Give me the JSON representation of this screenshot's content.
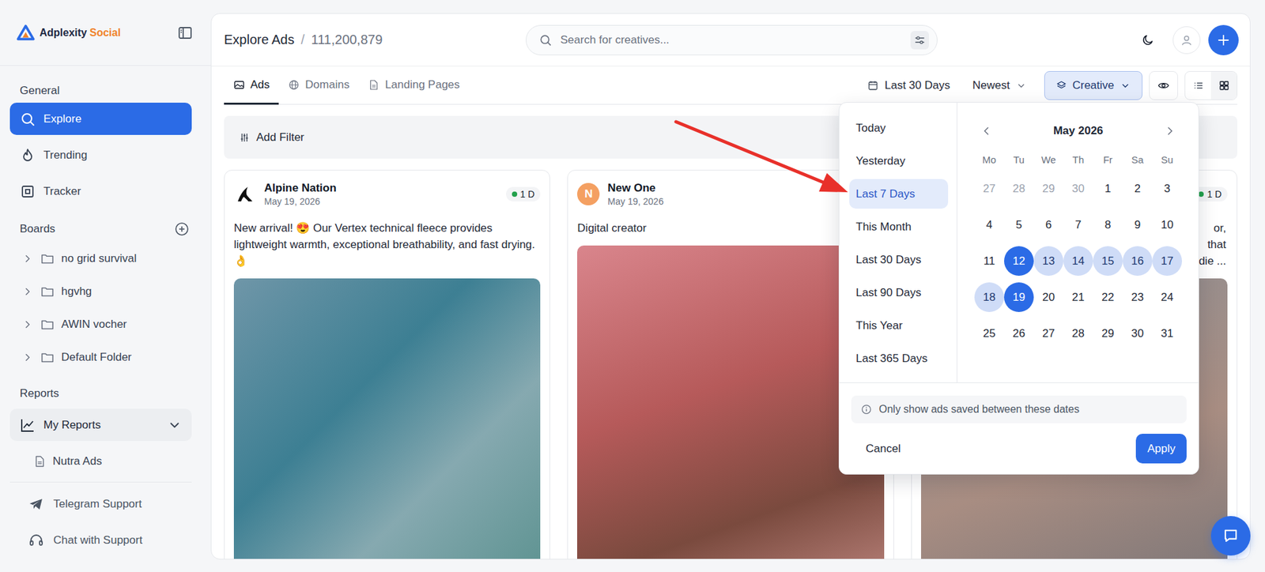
{
  "brand": {
    "name": "Adplexity",
    "accent": "Social"
  },
  "sidebar": {
    "general_title": "General",
    "nav": [
      {
        "label": "Explore",
        "selected": true
      },
      {
        "label": "Trending",
        "selected": false
      },
      {
        "label": "Tracker",
        "selected": false
      }
    ],
    "boards_title": "Boards",
    "boards": [
      {
        "label": "no grid survival",
        "expanded": false
      },
      {
        "label": "hgvhg",
        "expanded": false
      },
      {
        "label": "AWIN vocher",
        "expanded": false
      },
      {
        "label": "Default Folder",
        "expanded": false
      }
    ],
    "reports_title": "Reports",
    "reports": [
      {
        "label": "My Reports",
        "expanded": true,
        "children": [
          "Nutra Ads"
        ]
      }
    ],
    "support": [
      "Telegram Support",
      "Chat with Support"
    ]
  },
  "header": {
    "title": "Explore Ads",
    "separator": "/",
    "count": "111,200,879",
    "search_placeholder": "Search for creatives..."
  },
  "tabs": [
    {
      "label": "Ads",
      "selected": true
    },
    {
      "label": "Domains",
      "selected": false
    },
    {
      "label": "Landing Pages",
      "selected": false
    }
  ],
  "toolbar": {
    "date_range": "Last 30 Days",
    "sort": "Newest",
    "creative": "Creative",
    "creative_active": true,
    "views": [
      {
        "name": "list",
        "selected": false
      },
      {
        "name": "grid",
        "selected": true
      }
    ]
  },
  "filter": {
    "label": "Add Filter"
  },
  "cards": [
    {
      "kind": "full",
      "name": "Alpine Nation",
      "date": "May 19, 2026",
      "badge": "1 D",
      "text": "New arrival! 😍 Our Vertex technical fleece provides lightweight warmth, exceptional breathability, and fast drying. 👌",
      "avatar_kind": "logo",
      "avatar_letter": "",
      "color": "#111111"
    },
    {
      "kind": "full",
      "name": "New One",
      "date": "May 19, 2026",
      "badge": "",
      "text": "Digital creator",
      "avatar_kind": "letter",
      "avatar_letter": "N",
      "color": "#f4a062"
    },
    {
      "kind": "partial",
      "badge": "1 D",
      "text_lines": [
        "or,",
        "that",
        "die ..."
      ]
    }
  ],
  "date_picker": {
    "presets": [
      {
        "label": "Today",
        "selected": false
      },
      {
        "label": "Yesterday",
        "selected": false
      },
      {
        "label": "Last 7 Days",
        "selected": true
      },
      {
        "label": "This Month",
        "selected": false
      },
      {
        "label": "Last 30 Days",
        "selected": false
      },
      {
        "label": "Last 90 Days",
        "selected": false
      },
      {
        "label": "This Year",
        "selected": false
      },
      {
        "label": "Last 365 Days",
        "selected": false
      }
    ],
    "month": "May 2026",
    "weekdays": [
      "Mo",
      "Tu",
      "We",
      "Th",
      "Fr",
      "Sa",
      "Su"
    ],
    "weeks": [
      [
        {
          "day": "27",
          "outside": true,
          "selected": false,
          "in_range": false
        },
        {
          "day": "28",
          "outside": true,
          "selected": false,
          "in_range": false
        },
        {
          "day": "29",
          "outside": true,
          "selected": false,
          "in_range": false
        },
        {
          "day": "30",
          "outside": true,
          "selected": false,
          "in_range": false
        },
        {
          "day": "1",
          "outside": false,
          "selected": false,
          "in_range": false
        },
        {
          "day": "2",
          "outside": false,
          "selected": false,
          "in_range": false
        },
        {
          "day": "3",
          "outside": false,
          "selected": false,
          "in_range": false
        }
      ],
      [
        {
          "day": "4",
          "outside": false,
          "selected": false,
          "in_range": false
        },
        {
          "day": "5",
          "outside": false,
          "selected": false,
          "in_range": false
        },
        {
          "day": "6",
          "outside": false,
          "selected": false,
          "in_range": false
        },
        {
          "day": "7",
          "outside": false,
          "selected": false,
          "in_range": false
        },
        {
          "day": "8",
          "outside": false,
          "selected": false,
          "in_range": false
        },
        {
          "day": "9",
          "outside": false,
          "selected": false,
          "in_range": false
        },
        {
          "day": "10",
          "outside": false,
          "selected": false,
          "in_range": false
        }
      ],
      [
        {
          "day": "11",
          "outside": false,
          "selected": false,
          "in_range": false
        },
        {
          "day": "12",
          "outside": false,
          "selected": true,
          "in_range": true
        },
        {
          "day": "13",
          "outside": false,
          "selected": false,
          "in_range": true
        },
        {
          "day": "14",
          "outside": false,
          "selected": false,
          "in_range": true
        },
        {
          "day": "15",
          "outside": false,
          "selected": false,
          "in_range": true
        },
        {
          "day": "16",
          "outside": false,
          "selected": false,
          "in_range": true
        },
        {
          "day": "17",
          "outside": false,
          "selected": false,
          "in_range": true
        }
      ],
      [
        {
          "day": "18",
          "outside": false,
          "selected": false,
          "in_range": true
        },
        {
          "day": "19",
          "outside": false,
          "selected": true,
          "in_range": true
        },
        {
          "day": "20",
          "outside": false,
          "selected": false,
          "in_range": false
        },
        {
          "day": "21",
          "outside": false,
          "selected": false,
          "in_range": false
        },
        {
          "day": "22",
          "outside": false,
          "selected": false,
          "in_range": false
        },
        {
          "day": "23",
          "outside": false,
          "selected": false,
          "in_range": false
        },
        {
          "day": "24",
          "outside": false,
          "selected": false,
          "in_range": false
        }
      ],
      [
        {
          "day": "25",
          "outside": false,
          "selected": false,
          "in_range": false
        },
        {
          "day": "26",
          "outside": false,
          "selected": false,
          "in_range": false
        },
        {
          "day": "27",
          "outside": false,
          "selected": false,
          "in_range": false
        },
        {
          "day": "28",
          "outside": false,
          "selected": false,
          "in_range": false
        },
        {
          "day": "29",
          "outside": false,
          "selected": false,
          "in_range": false
        },
        {
          "day": "30",
          "outside": false,
          "selected": false,
          "in_range": false
        },
        {
          "day": "31",
          "outside": false,
          "selected": false,
          "in_range": false
        }
      ]
    ],
    "note": "Only show ads saved between these dates",
    "cancel": "Cancel",
    "apply": "Apply"
  }
}
